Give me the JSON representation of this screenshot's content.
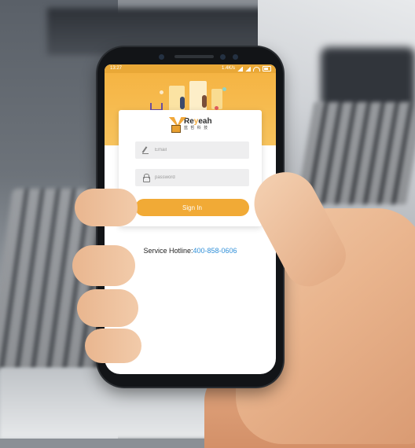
{
  "status_bar": {
    "time": "13:27",
    "speed": "1.4K/s"
  },
  "brand": {
    "name_prefix": "Re",
    "name_accent": "y",
    "name_suffix": "eah",
    "subtitle": "蓝 哲 科 技",
    "accent_color": "#f1a83a"
  },
  "login": {
    "email_placeholder": "Email",
    "password_placeholder": "password",
    "signin_label": "Sign In",
    "button_color": "#f1aa36"
  },
  "hotline": {
    "label": "Service Hotline:",
    "number": "400-858-0606"
  }
}
